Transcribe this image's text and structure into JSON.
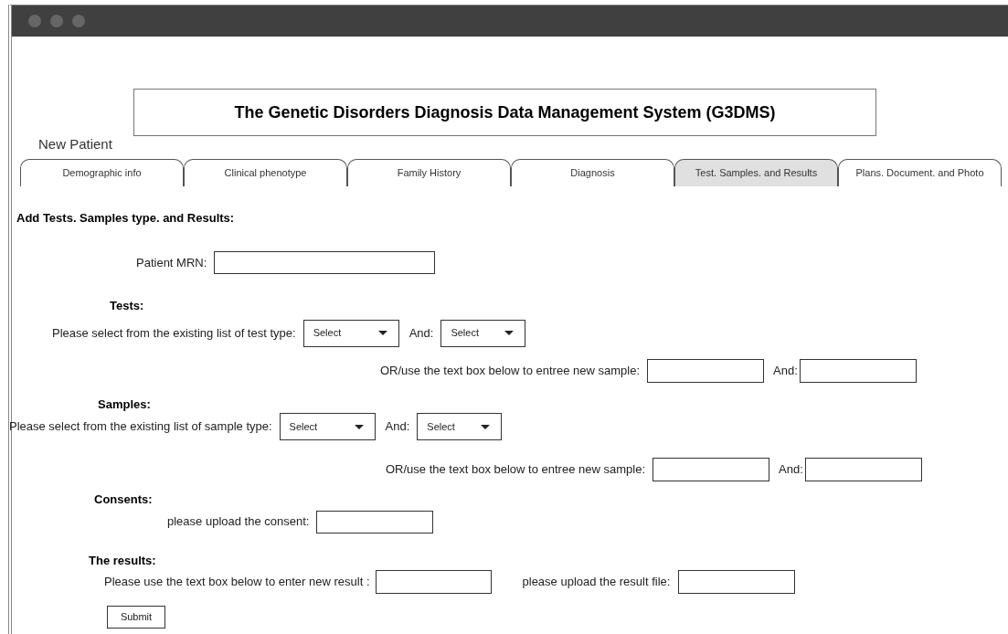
{
  "header": {
    "title": "The Genetic Disorders Diagnosis Data Management System (G3DMS)",
    "subtitle": "New Patient"
  },
  "tabs": [
    {
      "label": "Demographic info",
      "selected": false
    },
    {
      "label": "Clinical phenotype",
      "selected": false
    },
    {
      "label": "Family History",
      "selected": false
    },
    {
      "label": "Diagnosis",
      "selected": false
    },
    {
      "label": "Test. Samples. and Results",
      "selected": true
    },
    {
      "label": "Plans. Document. and Photo",
      "selected": false
    }
  ],
  "form": {
    "heading": "Add Tests. Samples type. and Results:",
    "mrn": {
      "label": "Patient MRN:"
    },
    "tests": {
      "heading": "Tests:",
      "select_label": "Please select from the existing list of test type:",
      "select_1": "Select",
      "and_1": "And:",
      "select_2": "Select",
      "or_label": "OR/use the text box below to entree new sample:",
      "and_2": "And:"
    },
    "samples": {
      "heading": "Samples:",
      "select_label": "Please select from the existing list of sample type:",
      "select_1": "Select",
      "and_1": "And:",
      "select_2": "Select",
      "or_label": "OR/use the text box below to entree new sample:",
      "and_2": "And:"
    },
    "consents": {
      "heading": "Consents:",
      "upload_label": "please upload the consent:"
    },
    "results": {
      "heading": "The results:",
      "text_label": "Please use the text box below to enter new result :",
      "upload_label": "please upload the result file:"
    },
    "submit": "Submit"
  }
}
